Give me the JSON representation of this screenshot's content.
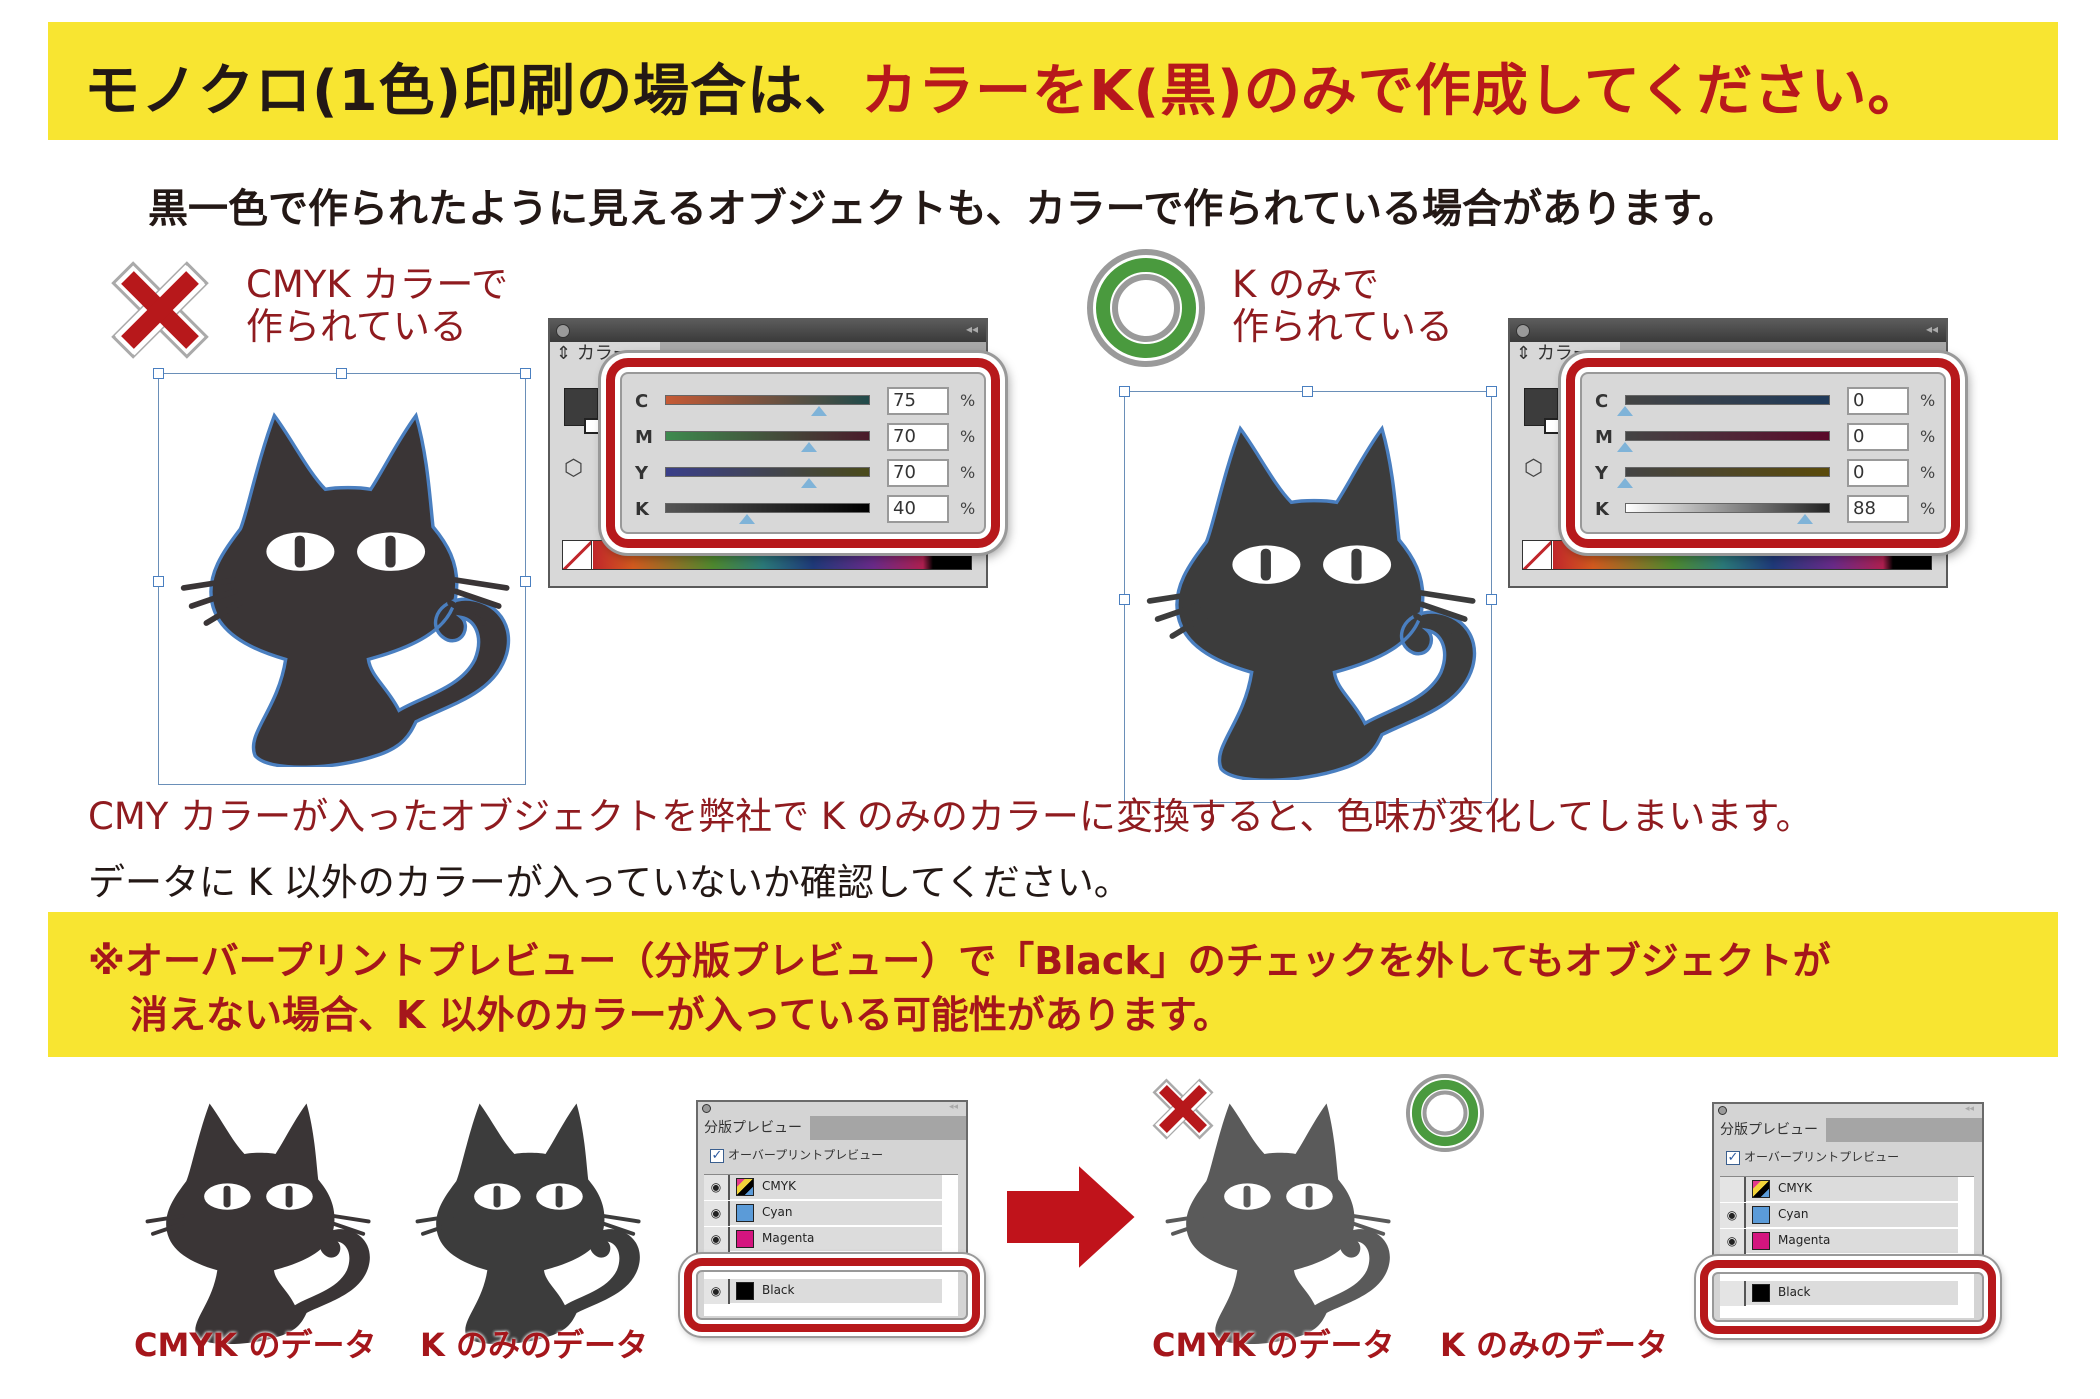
{
  "header": {
    "title_black": "モノクロ(1色)印刷の場合は、",
    "title_red": "カラーをK(黒)のみで作成してください。"
  },
  "subtitle": "黒一色で作られたように見えるオブジェクトも、カラーで作られている場合があります。",
  "examples": [
    {
      "verdict": "bad",
      "mark_icon": "cross-mark-icon",
      "label_line1": "CMYK カラーで",
      "label_line2": "作られている",
      "panel": {
        "tab_label": "カラー",
        "sliders": [
          {
            "channel": "C",
            "value": "75",
            "percent": 75,
            "unit": "%"
          },
          {
            "channel": "M",
            "value": "70",
            "percent": 70,
            "unit": "%"
          },
          {
            "channel": "Y",
            "value": "70",
            "percent": 70,
            "unit": "%"
          },
          {
            "channel": "K",
            "value": "40",
            "percent": 40,
            "unit": "%"
          }
        ]
      },
      "cat_color": "#3a3536"
    },
    {
      "verdict": "good",
      "mark_icon": "double-circle-icon",
      "label_line1": "K のみで",
      "label_line2": "作られている",
      "panel": {
        "tab_label": "カラー",
        "sliders": [
          {
            "channel": "C",
            "value": "0",
            "percent": 0,
            "unit": "%"
          },
          {
            "channel": "M",
            "value": "0",
            "percent": 0,
            "unit": "%"
          },
          {
            "channel": "Y",
            "value": "0",
            "percent": 0,
            "unit": "%"
          },
          {
            "channel": "K",
            "value": "88",
            "percent": 88,
            "unit": "%"
          }
        ]
      },
      "cat_color": "#3c3c3c"
    }
  ],
  "warning": {
    "line_red": "CMY カラーが入ったオブジェクトを弊社で K のみのカラーに変換すると、色味が変化してしまいます。",
    "line_black": "データに K 以外のカラーが入っていないか確認してください。"
  },
  "note": {
    "line1": "※オーバープリントプレビュー（分版プレビュー）で「Black」のチェックを外してもオブジェクトが",
    "line2": "消えない場合、K 以外のカラーが入っている可能性があります。"
  },
  "separations": {
    "before": {
      "tab_label": "分版プレビュー",
      "overprint_label": "オーバープリントプレビュー",
      "overprint_checked": true,
      "rows": [
        {
          "name": "CMYK",
          "visible": true,
          "chip": "cmyk"
        },
        {
          "name": "Cyan",
          "visible": true,
          "chip": "#5b9bd8"
        },
        {
          "name": "Magenta",
          "visible": true,
          "chip": "#d4157f"
        },
        {
          "name": "Black",
          "visible": true,
          "chip": "#000000"
        }
      ],
      "captions": [
        "CMYK のデータ",
        "K のみのデータ"
      ]
    },
    "after": {
      "tab_label": "分版プレビュー",
      "overprint_label": "オーバープリントプレビュー",
      "overprint_checked": true,
      "rows": [
        {
          "name": "CMYK",
          "visible": false,
          "chip": "cmyk"
        },
        {
          "name": "Cyan",
          "visible": true,
          "chip": "#5b9bd8"
        },
        {
          "name": "Magenta",
          "visible": true,
          "chip": "#d4157f"
        },
        {
          "name": "Black",
          "visible": false,
          "chip": "#000000"
        }
      ],
      "captions": [
        "CMYK のデータ",
        "K のみのデータ"
      ],
      "result_marks": [
        "cross-mark-icon",
        "double-circle-icon"
      ]
    }
  },
  "colors": {
    "banner_yellow": "#f8e531",
    "accent_red": "#b7181b",
    "label_red": "#8f1b1f",
    "ok_green": "#4a9a3e",
    "cat_dark": "#3a3536",
    "cat_faded": "#5a5a5a",
    "selection_blue": "#4a7fc0"
  }
}
